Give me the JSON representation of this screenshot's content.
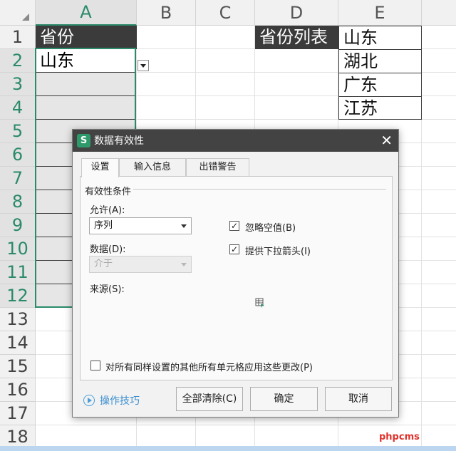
{
  "sheet": {
    "columns": [
      "A",
      "B",
      "C",
      "D",
      "E"
    ],
    "rows": [
      "1",
      "2",
      "3",
      "4",
      "5",
      "6",
      "7",
      "8",
      "9",
      "10",
      "11",
      "12",
      "13",
      "14",
      "15",
      "16",
      "17",
      "18"
    ],
    "a1": "省份",
    "a2": "山东",
    "d1": "省份列表",
    "province_list": [
      "山东",
      "湖北",
      "广东",
      "江苏"
    ]
  },
  "dialog": {
    "title": "数据有效性",
    "app_icon_letter": "S",
    "tabs": [
      "设置",
      "输入信息",
      "出错警告"
    ],
    "active_tab": "设置",
    "group_title": "有效性条件",
    "allow_label": "允许(A):",
    "allow_value": "序列",
    "data_label": "数据(D):",
    "data_value": "介于",
    "source_label": "来源(S):",
    "ignore_blank_label": "忽略空值(B)",
    "ignore_blank_checked": true,
    "dropdown_arrow_label": "提供下拉箭头(I)",
    "dropdown_arrow_checked": true,
    "apply_all_label": "对所有同样设置的其他所有单元格应用这些更改(P)",
    "apply_all_checked": false,
    "help_link": "操作技巧",
    "buttons": {
      "clear_all": "全部清除(C)",
      "ok": "确定",
      "cancel": "取消"
    },
    "close_glyph": "✕",
    "check_glyph": "✓"
  },
  "watermark": "phpcms",
  "colors": {
    "accent": "#2a8a6a",
    "header_dark": "#3b3b3b",
    "link": "#3a8fd0",
    "titlebar": "#434343"
  }
}
